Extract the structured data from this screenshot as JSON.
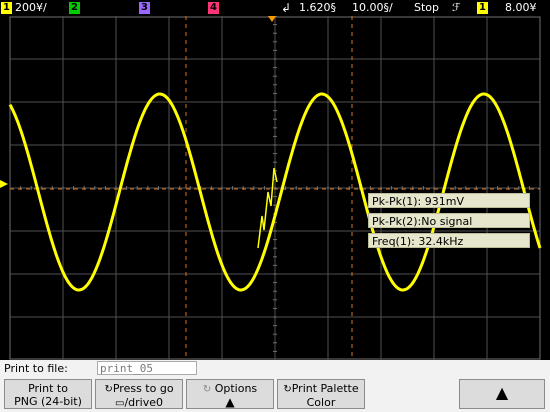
{
  "topbar": {
    "ch1_num": "1",
    "ch1_scale": "200¥/",
    "ch2_num": "2",
    "ch3_num": "3",
    "ch4_num": "4",
    "trigger_icon": "trigger-edge-icon",
    "time_delay": "1.620§",
    "time_scale": "10.00§/",
    "run_state": "Stop",
    "trigger_slope": "ℱ",
    "trigger_source": "1",
    "trigger_level": "8.00¥",
    "colors": {
      "ch1": "#ffff00",
      "ch2": "#00cc00",
      "ch3": "#9966ff",
      "ch4": "#ff3377"
    }
  },
  "measurements": {
    "pkpk1": "Pk-Pk(1): 931mV",
    "pkpk2": "Pk-Pk(2):No signal",
    "freq1": "Freq(1): 32.4kHz"
  },
  "print": {
    "label": "Print to file:",
    "filename": "print_05"
  },
  "softkeys": {
    "print_to_line1": "Print to",
    "print_to_line2": "PNG (24-bit)",
    "press_to_go_line1": "Press to go",
    "press_to_go_line2": "/drive0",
    "options": "Options",
    "palette_line1": "Print Palette",
    "palette_line2": "Color"
  },
  "waveform": {
    "channel": "1",
    "color": "#ffff00",
    "frequency": "32.4kHz",
    "amplitude_pkpk": "931mV"
  }
}
